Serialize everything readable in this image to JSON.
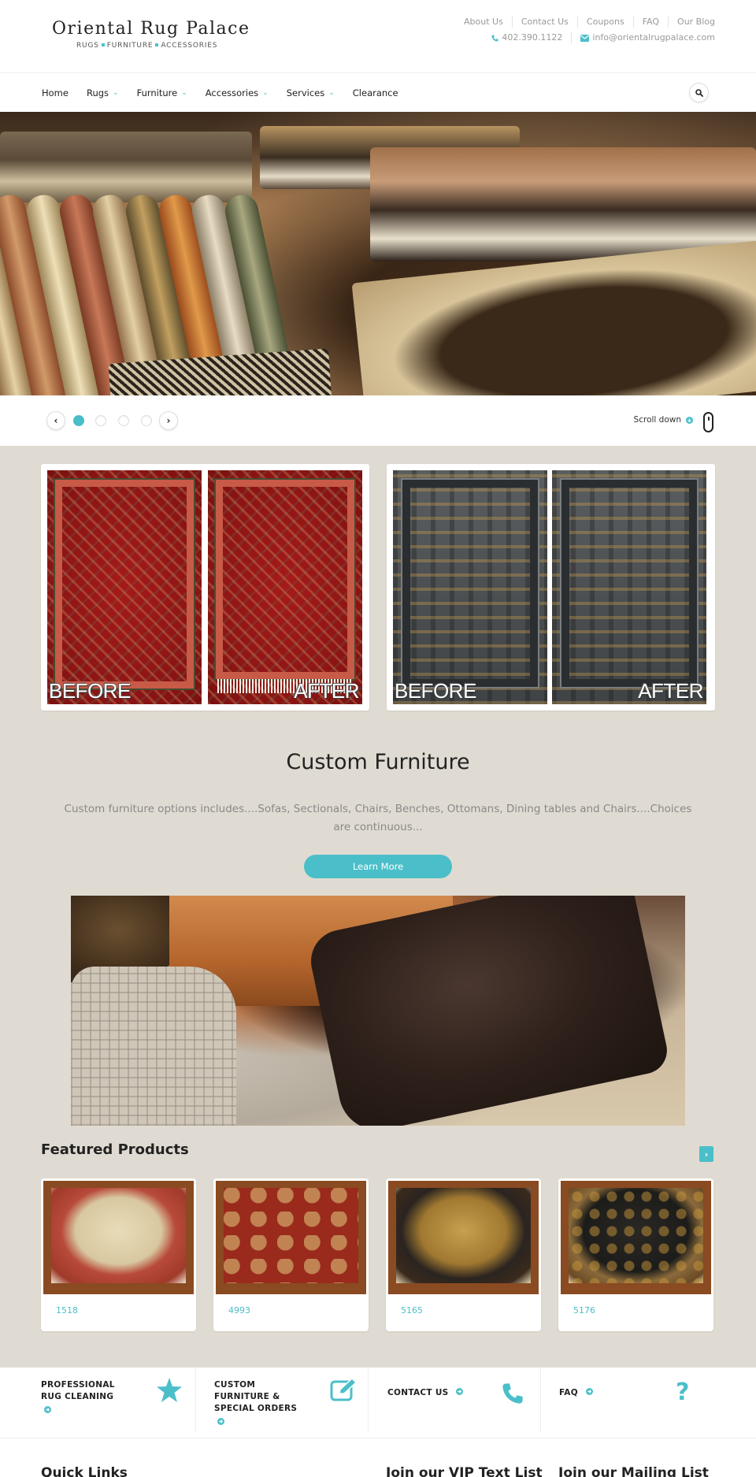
{
  "header": {
    "logo_title": "Oriental Rug Palace",
    "logo_tagline": [
      "RUGS",
      "FURNITURE",
      "ACCESSORIES"
    ],
    "top_links": [
      "About Us",
      "Contact Us",
      "Coupons",
      "FAQ",
      "Our Blog"
    ],
    "phone": "402.390.1122",
    "email": "info@orientalrugpalace.com",
    "accent_color": "#4bbfc9"
  },
  "nav": {
    "items": [
      {
        "label": "Home",
        "has_dropdown": false
      },
      {
        "label": "Rugs",
        "has_dropdown": true
      },
      {
        "label": "Furniture",
        "has_dropdown": true
      },
      {
        "label": "Accessories",
        "has_dropdown": true
      },
      {
        "label": "Services",
        "has_dropdown": true
      },
      {
        "label": "Clearance",
        "has_dropdown": false
      }
    ],
    "search_icon": "search-icon"
  },
  "slider": {
    "slide_count": 4,
    "active_slide": 1,
    "scroll_label": "Scroll down"
  },
  "before_after": {
    "before_label": "BEFORE",
    "after_label": "AFTER"
  },
  "custom_furniture": {
    "title": "Custom Furniture",
    "description": "Custom furniture options includes....Sofas, Sectionals, Chairs, Benches, Ottomans, Dining tables and Chairs....Choices are continuous...",
    "button_label": "Learn More"
  },
  "featured": {
    "title": "Featured Products",
    "products": [
      {
        "code": "1518"
      },
      {
        "code": "4993"
      },
      {
        "code": "5165"
      },
      {
        "code": "5176"
      }
    ]
  },
  "services": [
    {
      "label": "PROFESSIONAL\nRUG CLEANING",
      "icon": "star-icon"
    },
    {
      "label": "CUSTOM\nFURNITURE &\nSPECIAL ORDERS",
      "icon": "edit-icon"
    },
    {
      "label": "CONTACT US",
      "icon": "phone-icon"
    },
    {
      "label": "FAQ",
      "icon": "question-icon"
    }
  ],
  "footer": {
    "quick_links_title": "Quick Links",
    "vip_title": "Join our VIP Text List",
    "mailing_title": "Join our Mailing List"
  }
}
